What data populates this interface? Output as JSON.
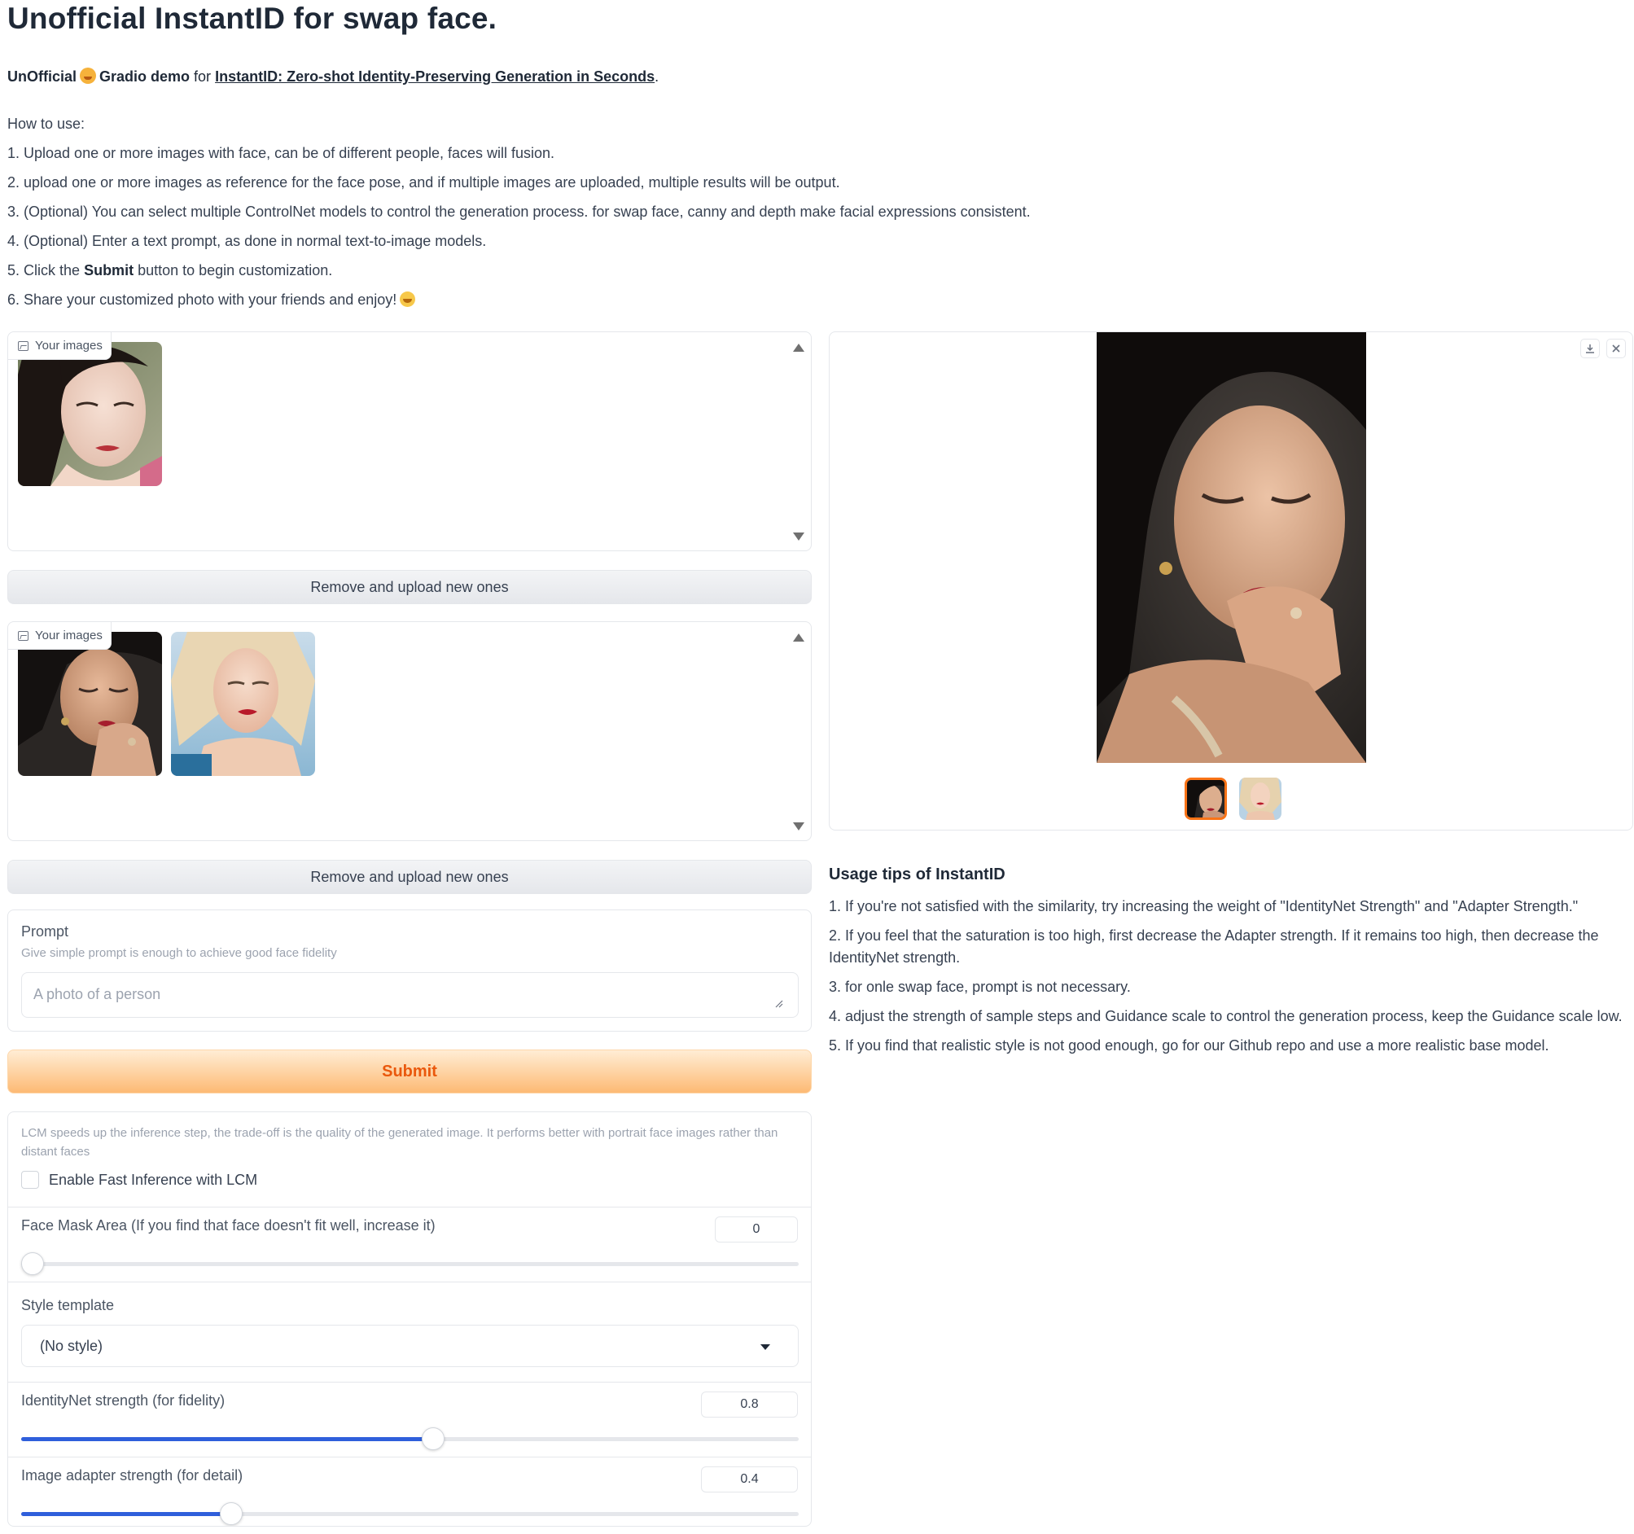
{
  "title": "Unofficial InstantID for swap face.",
  "intro": {
    "prefix": "UnOfficial",
    "gradio": "Gradio demo",
    "for": "for",
    "link_text": "InstantID: Zero-shot Identity-Preserving Generation in Seconds",
    "suffix": "."
  },
  "howto": {
    "heading": "How to use:",
    "step1": "1. Upload one or more images with face, can be of different people, faces will fusion.",
    "step2": "2. upload one or more images as reference for the face pose, and if multiple images are uploaded, multiple results will be output.",
    "step3": "3. (Optional) You can select multiple ControlNet models to control the generation process. for swap face, canny and depth make facial expressions consistent.",
    "step4": "4. (Optional) Enter a text prompt, as done in normal text-to-image models.",
    "step5_a": "5. Click the",
    "step5_b": "Submit",
    "step5_c": "button to begin customization.",
    "step6": "6. Share your customized photo with your friends and enjoy!"
  },
  "face_gallery": {
    "label": "Your images",
    "image_count": 1
  },
  "remove_button_label": "Remove and upload new ones",
  "pose_gallery": {
    "label": "Your images",
    "image_count": 2
  },
  "prompt": {
    "label": "Prompt",
    "info": "Give simple prompt is enough to achieve good face fidelity",
    "placeholder": "A photo of a person",
    "value": ""
  },
  "submit_label": "Submit",
  "lcm": {
    "info": "LCM speeds up the inference step, the trade-off is the quality of the generated image. It performs better with portrait face images rather than distant faces",
    "checkbox_label": "Enable Fast Inference with LCM",
    "checked": false
  },
  "face_mask": {
    "label": "Face Mask Area (If you find that face doesn't fit well, increase it)",
    "value": "0",
    "fraction": 0.0
  },
  "style": {
    "label": "Style template",
    "value": "(No style)"
  },
  "identitynet": {
    "label": "IdentityNet strength (for fidelity)",
    "value": "0.8",
    "fraction": 0.53
  },
  "adapter": {
    "label": "Image adapter strength (for detail)",
    "value": "0.4",
    "fraction": 0.27
  },
  "output": {
    "download_icon": "download-icon",
    "close_icon": "close-icon",
    "thumbnail_count": 2,
    "selected_index": 0
  },
  "tips": {
    "title": "Usage tips of InstantID",
    "items": [
      "1. If you're not satisfied with the similarity, try increasing the weight of \"IdentityNet Strength\" and \"Adapter Strength.\"",
      "2. If you feel that the saturation is too high, first decrease the Adapter strength. If it remains too high, then decrease the IdentityNet strength.",
      "3. for onle swap face, prompt is not necessary.",
      "4. adjust the strength of sample steps and Guidance scale to control the generation process, keep the Guidance scale low.",
      "5. If you find that realistic style is not good enough, go for our Github repo and use a more realistic base model."
    ]
  },
  "colors": {
    "accent_orange": "#ea580c",
    "slider_blue": "#2f5fdb"
  }
}
